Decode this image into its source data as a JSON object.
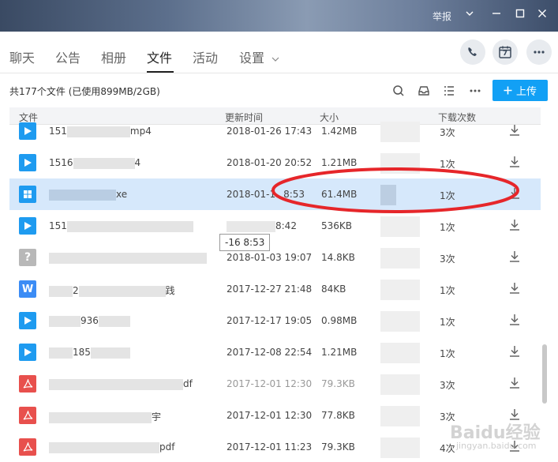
{
  "titlebar": {
    "report_label": "举报",
    "controls": [
      "chevron-down-icon",
      "minimize-icon",
      "maximize-icon",
      "close-icon"
    ]
  },
  "tabs": [
    {
      "label": "聊天",
      "active": false
    },
    {
      "label": "公告",
      "active": false
    },
    {
      "label": "相册",
      "active": false
    },
    {
      "label": "文件",
      "active": true
    },
    {
      "label": "活动",
      "active": false
    },
    {
      "label": "设置",
      "active": false,
      "dropdown": true
    }
  ],
  "header_actions": [
    "phone-icon",
    "calendar-icon",
    "more-icon"
  ],
  "calendar_day": "7",
  "toolbar": {
    "file_count": "共177个文件 (已使用899MB/2GB)",
    "upload_label": "上传",
    "icons": [
      "search-icon",
      "inbox-icon",
      "list-view-icon",
      "more-icon"
    ]
  },
  "columns": {
    "name": "文件",
    "time": "更新时间",
    "size": "大小",
    "downloads": "下载次数"
  },
  "rows": [
    {
      "icon": "video",
      "name": "151",
      "name_tail": "mp4",
      "time": "2018-01-26 17:43",
      "size": "1.42MB",
      "downloads": "3次"
    },
    {
      "icon": "video",
      "name": "1516",
      "name_tail": "4",
      "time": "2018-01-20 20:52",
      "size": "1.21MB",
      "downloads": "1次"
    },
    {
      "icon": "exe",
      "name": "",
      "name_tail": "xe",
      "time": "2018-01-1",
      "time_tail": "8:53",
      "size": "61.4MB",
      "downloads": "1次",
      "selected": true
    },
    {
      "icon": "video",
      "name": "151",
      "name_tail": "",
      "time": "",
      "time_tail": "8:42",
      "size": "536KB",
      "downloads": "1次"
    },
    {
      "icon": "unknown",
      "name": "",
      "name_tail": "",
      "time": "2018-01-03 19:07",
      "size": "14.8KB",
      "downloads": "3次"
    },
    {
      "icon": "word",
      "name": "2",
      "name_tail": "践",
      "time": "2017-12-27 21:48",
      "size": "84KB",
      "downloads": "1次"
    },
    {
      "icon": "video",
      "name": "936",
      "name_tail": "",
      "time": "2017-12-17 19:05",
      "size": "0.98MB",
      "downloads": "1次"
    },
    {
      "icon": "video",
      "name": "185",
      "name_tail": "",
      "time": "2017-12-08 22:54",
      "size": "1.21MB",
      "downloads": "1次"
    },
    {
      "icon": "pdf",
      "name": "",
      "name_tail": "df",
      "time": "2017-12-01 12:30",
      "size": "79.3KB",
      "downloads": "3次"
    },
    {
      "icon": "pdf",
      "name": "",
      "name_tail": "宇",
      "time": "2017-12-01 12:30",
      "size": "77.8KB",
      "downloads": "3次"
    },
    {
      "icon": "pdf",
      "name": "",
      "name_tail": "pdf",
      "time": "2017-12-01 11:23",
      "size": "79.3KB",
      "downloads": "4次"
    }
  ],
  "tooltip": "-16 8:53",
  "colors": {
    "accent": "#12a0f5",
    "selected_row": "#d6e8fb",
    "video": "#1e9bf0",
    "word": "#3b8cf5",
    "pdf": "#e8504d",
    "unknown": "#b8b8b8",
    "annotation": "#e6262a"
  },
  "watermark": {
    "text": "Baidu经验",
    "sub": "jingyan.baidu.com"
  }
}
